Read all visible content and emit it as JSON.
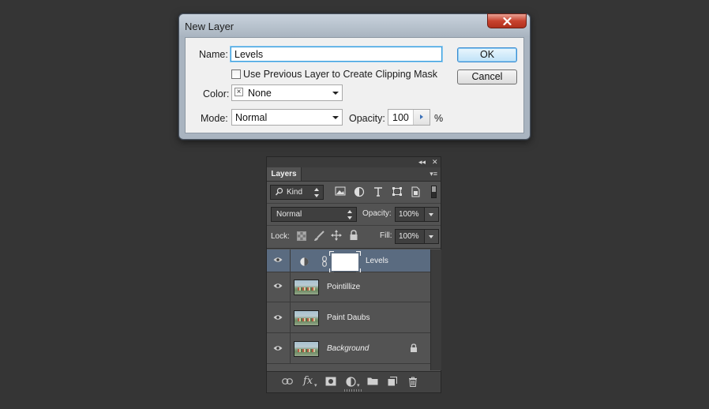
{
  "dialog": {
    "title": "New Layer",
    "name_label": "Name:",
    "name_value": "Levels",
    "clipping_label": "Use Previous Layer to Create Clipping Mask",
    "color_label": "Color:",
    "color_value": "None",
    "mode_label": "Mode:",
    "mode_value": "Normal",
    "opacity_label": "Opacity:",
    "opacity_value": "100",
    "opacity_unit": "%",
    "ok_label": "OK",
    "cancel_label": "Cancel"
  },
  "panel": {
    "tab": "Layers",
    "filter_kind": "Kind",
    "blend_mode": "Normal",
    "opacity_label": "Opacity:",
    "opacity_value": "100%",
    "lock_label": "Lock:",
    "fill_label": "Fill:",
    "fill_value": "100%",
    "layers": [
      {
        "name": "Levels",
        "selected": true
      },
      {
        "name": "Pointillize"
      },
      {
        "name": "Paint Daubs"
      },
      {
        "name": "Background",
        "locked": true
      }
    ]
  },
  "colors": {
    "desktop": "#353535",
    "panel": "#535353",
    "selected_layer": "#5a6b80",
    "focus_blue": "#3c9fdc"
  }
}
